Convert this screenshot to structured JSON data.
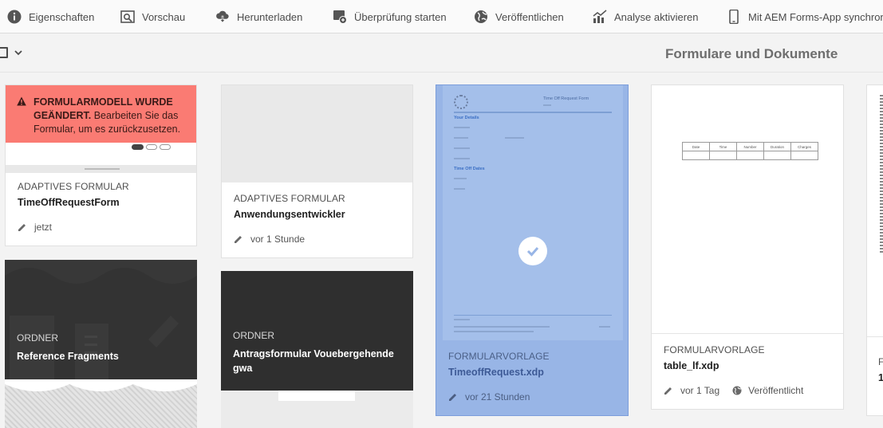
{
  "toolbar": {
    "properties": "Eigenschaften",
    "preview": "Vorschau",
    "download": "Herunterladen",
    "start_review": "Überprüfung starten",
    "publish": "Veröffentlichen",
    "enable_analytics": "Analyse aktivieren",
    "sync_app": "Mit AEM Forms-App synchronisi"
  },
  "header": {
    "title": "Formulare und Dokumente"
  },
  "colors": {
    "warning": "#fa7b73",
    "selected": "#98b5e6",
    "folder": "#2f2f2f",
    "accent_text": "#3d5a96"
  },
  "cards": [
    {
      "type": "ADAPTIVES FORMULAR",
      "title": "TimeOffRequestForm",
      "meta": "jetzt",
      "warning_bold": "FORMULARMODELL WURDE GEÄNDERT.",
      "warning_text": " Bearbeiten Sie das Formular, um es zurückzusetzen."
    },
    {
      "type": "ADAPTIVES FORMULAR",
      "title": "Anwendungsentwickler",
      "meta": "vor 1 Stunde"
    },
    {
      "type": "ORDNER",
      "title": "Reference Fragments"
    },
    {
      "type": "ORDNER",
      "title": "Antragsformular Vouebergehende gwa"
    },
    {
      "type": "FORMULARVORLAGE",
      "title": "TimeoffRequest.xdp",
      "meta": "vor 21 Stunden",
      "selected": true,
      "thumb": {
        "heading": "Time Off Request Form",
        "section1": "Your Details",
        "section2": "Time Off Dates"
      }
    },
    {
      "type": "FORMULARVORLAGE",
      "title": "table_lf.xdp",
      "meta": "vor 1 Tag",
      "status": "Veröffentlicht",
      "thumb_columns": [
        "Date",
        "Time",
        "Number",
        "Duration",
        "Charges"
      ]
    },
    {
      "type": "F",
      "title": "1"
    }
  ]
}
